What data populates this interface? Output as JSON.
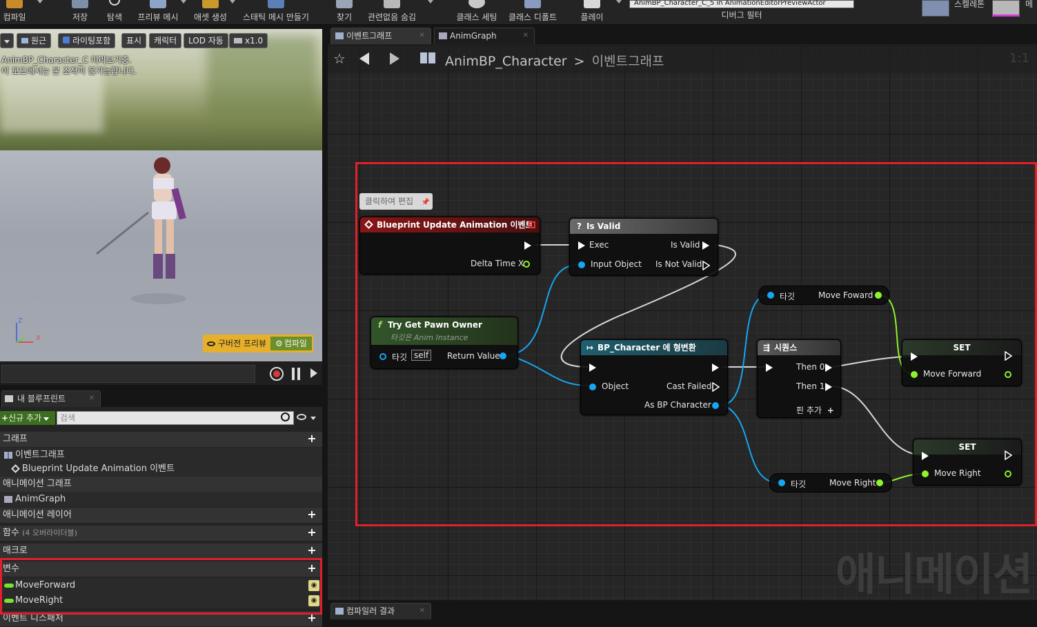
{
  "toolbar": {
    "compile": "컴파일",
    "save": "저장",
    "browse": "탐색",
    "preview_mesh": "프리뷰 메시",
    "create_asset": "애셋 생성",
    "make_static_mesh": "스태틱 메시 만들기",
    "find": "찾기",
    "hide_unrelated": "관련없음 숨김",
    "class_settings": "클래스 세팅",
    "class_defaults": "클래스 디폴트",
    "play": "플레이",
    "debug_object": "AnimBP_Character_C_5 in AnimationEditorPreviewActor",
    "debug_filter": "디버그 필터",
    "skeleton_mode": "스켈레톤",
    "mesh_mode": "메"
  },
  "viewport": {
    "perspective": "원근",
    "lighting": "라이팅포함",
    "show": "표시",
    "character": "캐릭터",
    "lod": "LOD 자동",
    "speed": "x1.0",
    "info_line1": "AnimBP_Character_C 미리보기중.",
    "info_line2": "이 모드에서는 본 조작이 불가능합니다.",
    "old_preview": "구버전 프리뷰",
    "compile": "컴파일",
    "axis_z": "Z",
    "axis_x": "X"
  },
  "my_blueprint": {
    "tab": "내 블루프린트",
    "add_new": "신규 추가",
    "search_placeholder": "검색",
    "sections": {
      "graphs": "그래프",
      "event_graph": "이벤트그래프",
      "bp_update_event": "Blueprint Update Animation 이벤트",
      "anim_graphs": "애니메이션 그래프",
      "anim_graph": "AnimGraph",
      "anim_layers": "애니메이션 레이어",
      "functions": "함수",
      "functions_sub": "(4 오버라이더블)",
      "macros": "매크로",
      "variables": "변수",
      "var1": "MoveForward",
      "var2": "MoveRight",
      "dispatchers": "이벤트 디스패처"
    }
  },
  "graph_tabs": {
    "event_graph": "이벤트그래프",
    "anim_graph": "AnimGraph"
  },
  "graph": {
    "breadcrumb_asset": "AnimBP_Character",
    "breadcrumb_sep": ">",
    "breadcrumb_graph": "이벤트그래프",
    "zoom": "1:1",
    "watermark": "애니메이션",
    "comment": "클릭하여 편집",
    "nodes": {
      "event": {
        "title": "Blueprint Update Animation 이벤트",
        "delta": "Delta Time X"
      },
      "isvalid": {
        "title": "Is Valid",
        "exec": "Exec",
        "input": "Input Object",
        "valid": "Is Valid",
        "notvalid": "Is Not Valid"
      },
      "pawn": {
        "title": "Try Get Pawn Owner",
        "subtitle": "타깃은 Anim Instance",
        "target": "타깃",
        "self": "self",
        "ret": "Return Value"
      },
      "cast": {
        "title": "BP_Character 에 형변환",
        "object": "Object",
        "failed": "Cast Failed",
        "as": "As BP Character"
      },
      "seq": {
        "title": "시퀀스",
        "then0": "Then 0",
        "then1": "Then 1",
        "add": "핀 추가"
      },
      "getfwd": {
        "target": "타깃",
        "value": "Move Foward"
      },
      "getright": {
        "target": "타깃",
        "value": "Move Right"
      },
      "set1": {
        "title": "SET",
        "value": "Move Forward"
      },
      "set2": {
        "title": "SET",
        "value": "Move Right"
      }
    }
  },
  "bottom": {
    "compiler_results": "컴파일러 결과"
  },
  "colors": {
    "highlight": "#e3202a",
    "event_header": "#8a1616",
    "function_header": "#33552a",
    "cast_header": "#1f4f5c",
    "exec_wire": "#d8d8d8",
    "object_wire": "#16a6f2",
    "float_wire": "#8ff22a"
  }
}
